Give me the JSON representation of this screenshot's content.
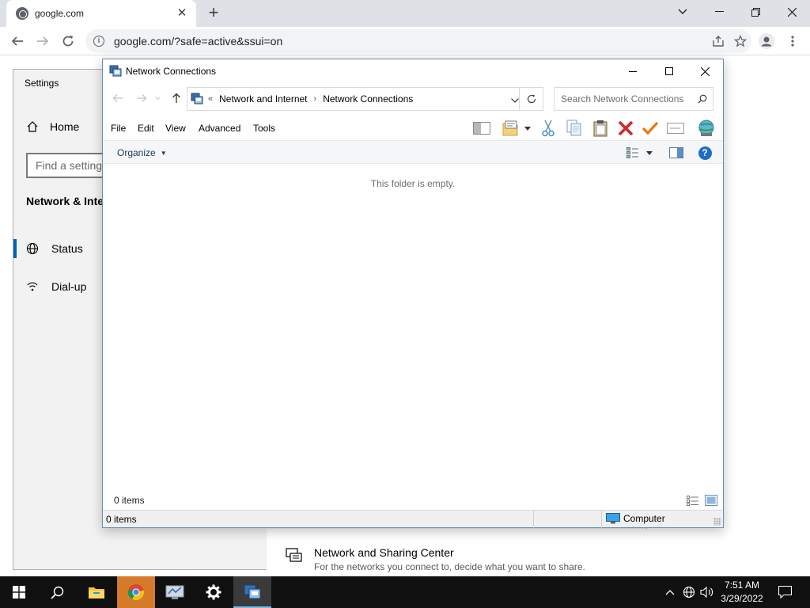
{
  "browser": {
    "tab_title": "google.com",
    "url": "google.com/?safe=active&ssui=on"
  },
  "settings": {
    "window_title": "Settings",
    "home_label": "Home",
    "search_placeholder": "Find a setting",
    "section_title": "Network & Internet",
    "nav": [
      {
        "label": "Status",
        "icon": "globe-icon",
        "active": true
      },
      {
        "label": "Dial-up",
        "icon": "dialup-icon",
        "active": false
      }
    ],
    "sharing_center": {
      "title": "Network and Sharing Center",
      "description": "For the networks you connect to, decide what you want to share."
    }
  },
  "explorer": {
    "window_title": "Network Connections",
    "address": {
      "overflow": "«",
      "segments": [
        "Network and Internet",
        "Network Connections"
      ]
    },
    "search_placeholder": "Search Network Connections",
    "menu": [
      "File",
      "Edit",
      "View",
      "Advanced",
      "Tools"
    ],
    "organize_label": "Organize",
    "empty_message": "This folder is empty.",
    "details_count": "0 items",
    "status": {
      "count": "0 items",
      "zone": "Computer"
    }
  },
  "taskbar": {
    "apps": [
      "start",
      "search",
      "file-explorer",
      "chrome",
      "network-app",
      "settings",
      "network-connections"
    ],
    "time": "7:51 AM",
    "date": "3/29/2022"
  },
  "colors": {
    "accent": "#0063b1",
    "taskbar": "#101010",
    "chrome_tabstrip": "#dee1e6",
    "delete_red": "#d3262a",
    "check_orange": "#e8790c"
  }
}
